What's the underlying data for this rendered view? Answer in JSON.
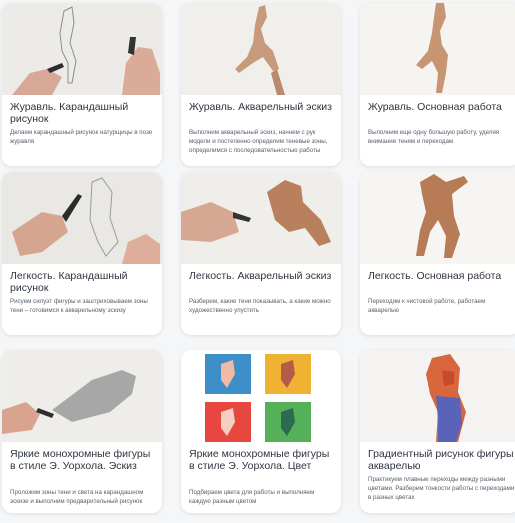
{
  "cards": [
    {
      "title": "Журавль. Карандашный рисунок",
      "description": "Делаем карандашный рисунок натурщицы в позе журавля",
      "icon": "pencil-sketch-thumbnail"
    },
    {
      "title": "Журавль. Акварельный эскиз",
      "description": "Выполним акварельный эскиз, начнем с рук модели и постепенно определим теневые зоны, определимся с последовательностью работы",
      "icon": "watercolor-sketch-thumbnail"
    },
    {
      "title": "Журавль. Основная работа",
      "description": "Выполним еще одну большую работу, уделяя внимание теням и переходам",
      "icon": "watercolor-figure-thumbnail"
    },
    {
      "title": "Легкость. Карандашный рисунок",
      "description": "Рисуем силуэт фигуры и заштриховываем зоны тени – готовимся к акварельному эскизу",
      "icon": "pencil-sketch-thumbnail"
    },
    {
      "title": "Легкость. Акварельный эскиз",
      "description": "Разберем, какие тени показывать, а какие можно художественно упустить",
      "icon": "watercolor-sketch-thumbnail"
    },
    {
      "title": "Легкость. Основная работа",
      "description": "Переходим к чистовой работе, работаем акварелью",
      "icon": "watercolor-figure-thumbnail"
    },
    {
      "title": "Яркие монохромные фигуры в стиле Э. Уорхола. Эскиз",
      "description": "Проложим зоны тени и света на карандашном эскизе и выполним предварительный рисунок",
      "icon": "pencil-drawing-thumbnail"
    },
    {
      "title": "Яркие монохромные фигуры в стиле Э. Уорхола. Цвет",
      "description": "Подбираем цвета для работы и выполняем каждую разным цветом",
      "icon": "four-color-figures-thumbnail"
    },
    {
      "title": "Градиентный рисунок фигуры акварелью",
      "description": "Практикуем плавные переходы между разными цветами. Разберем тонкости работы с переходами в разных цветах",
      "icon": "gradient-watercolor-thumbnail"
    }
  ]
}
